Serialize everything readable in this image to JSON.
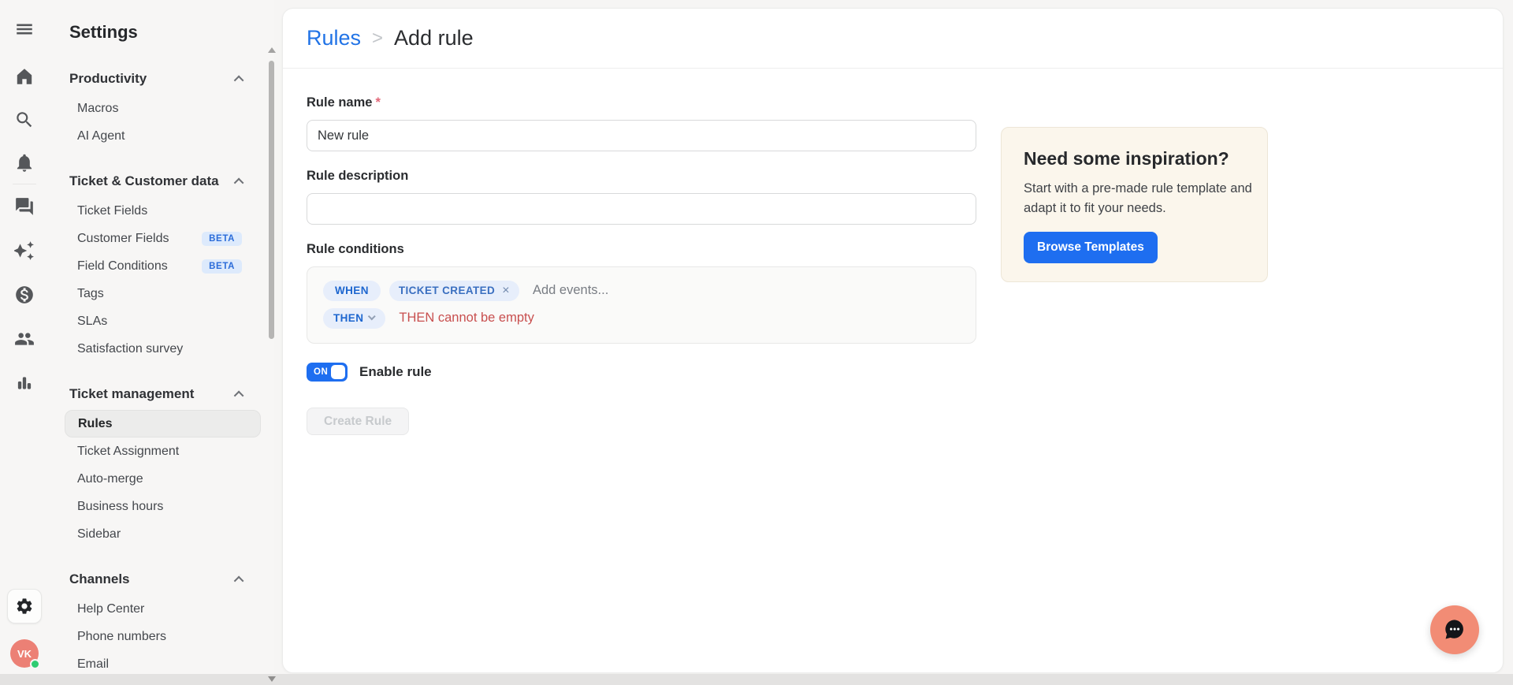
{
  "app": {
    "colors": {
      "accent_blue": "#1e6ef0",
      "link_blue": "#2173e6",
      "chip_bg": "#e7eefb",
      "chip_text": "#1d66cf",
      "error_red": "#c84f4f",
      "beta_bg": "#ddeafc",
      "beta_text": "#2b6cd9",
      "inspiration_bg": "#fbf6ec",
      "avatar_coral": "#ec8075",
      "launcher_coral": "#f28c75",
      "online_green": "#2ecc71"
    }
  },
  "rail": {
    "icons": [
      "menu",
      "home",
      "search",
      "notifications",
      "conversations",
      "ai-sparkles",
      "billing",
      "customers",
      "statistics"
    ],
    "bottom": [
      "settings-gear",
      "user-avatar"
    ]
  },
  "user": {
    "initials": "VK",
    "status": "online"
  },
  "sidebar": {
    "title": "Settings",
    "sections": [
      {
        "label": "Productivity",
        "items": [
          {
            "label": "Macros"
          },
          {
            "label": "AI Agent"
          }
        ]
      },
      {
        "label": "Ticket & Customer data",
        "items": [
          {
            "label": "Ticket Fields"
          },
          {
            "label": "Customer Fields",
            "badge": "BETA"
          },
          {
            "label": "Field Conditions",
            "badge": "BETA"
          },
          {
            "label": "Tags"
          },
          {
            "label": "SLAs"
          },
          {
            "label": "Satisfaction survey"
          }
        ]
      },
      {
        "label": "Ticket management",
        "items": [
          {
            "label": "Rules",
            "selected": true
          },
          {
            "label": "Ticket Assignment"
          },
          {
            "label": "Auto-merge"
          },
          {
            "label": "Business hours"
          },
          {
            "label": "Sidebar"
          }
        ]
      },
      {
        "label": "Channels",
        "items": [
          {
            "label": "Help Center"
          },
          {
            "label": "Phone numbers"
          },
          {
            "label": "Email"
          }
        ]
      }
    ]
  },
  "breadcrumb": {
    "link": "Rules",
    "separator": ">",
    "current": "Add rule"
  },
  "form": {
    "name_label": "Rule name",
    "required_mark": "*",
    "name_value": "New rule",
    "description_label": "Rule description",
    "description_value": "",
    "conditions_label": "Rule conditions",
    "when_label": "WHEN",
    "event_chip": "TICKET CREATED",
    "event_remove": "×",
    "add_events_placeholder": "Add events...",
    "then_label": "THEN",
    "then_error": "THEN cannot be empty",
    "toggle_state": "ON",
    "enable_label": "Enable rule",
    "create_button": "Create Rule"
  },
  "inspiration": {
    "title": "Need some inspiration?",
    "body": "Start with a pre-made rule template and adapt it to fit your needs.",
    "button": "Browse Templates"
  }
}
